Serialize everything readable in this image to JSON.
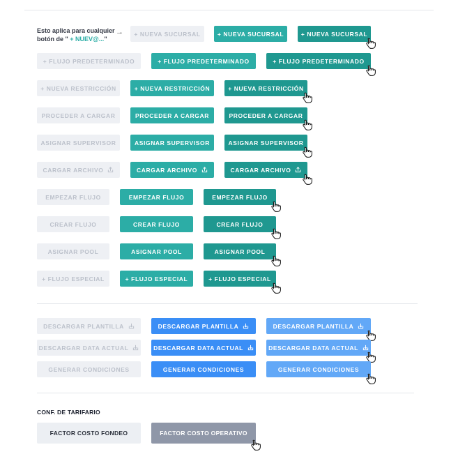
{
  "note": {
    "line1": "Esto aplica para cualquier",
    "line2_prefix": "botón de \"",
    "line2_highlight": " + NUEV@...",
    "line2_suffix": "\"",
    "arrow": "→"
  },
  "rows": [
    {
      "disabled": "+ NUEVA SUCURSAL",
      "normal": "+ NUEVA SUCURSAL",
      "hover": "+ NUEVA SUCURSAL"
    },
    {
      "disabled": "+  FLUJO PREDETERMINADO",
      "normal": "+  FLUJO PREDETERMINADO",
      "hover": "+  FLUJO PREDETERMINADO"
    },
    {
      "disabled": "+ NUEVA RESTRICCIÓN",
      "normal": "+ NUEVA RESTRICCIÓN",
      "hover": "+ NUEVA RESTRICCIÓN"
    },
    {
      "disabled": "PROCEDER A CARGAR",
      "normal": "PROCEDER A CARGAR",
      "hover": "PROCEDER A CARGAR"
    },
    {
      "disabled": "ASIGNAR SUPERVISOR",
      "normal": "ASIGNAR SUPERVISOR",
      "hover": "ASIGNAR SUPERVISOR"
    },
    {
      "disabled": "CARGAR ARCHIVO",
      "normal": "CARGAR ARCHIVO",
      "hover": "CARGAR ARCHIVO"
    },
    {
      "disabled": "EMPEZAR FLUJO",
      "normal": "EMPEZAR FLUJO",
      "hover": "EMPEZAR FLUJO"
    },
    {
      "disabled": "CREAR FLUJO",
      "normal": "CREAR FLUJO",
      "hover": "CREAR FLUJO"
    },
    {
      "disabled": "ASIGNAR POOL",
      "normal": "ASIGNAR POOL",
      "hover": "ASIGNAR POOL"
    },
    {
      "disabled": "+  FLUJO ESPECIAL",
      "normal": "+  FLUJO ESPECIAL",
      "hover": "+  FLUJO ESPECIAL"
    }
  ],
  "download_rows": [
    {
      "disabled": "DESCARGAR PLANTILLA",
      "normal": "DESCARGAR PLANTILLA",
      "hover": "DESCARGAR PLANTILLA"
    },
    {
      "disabled": "DESCARGAR DATA ACTUAL",
      "normal": "DESCARGAR DATA ACTUAL",
      "hover": "DESCARGAR DATA ACTUAL"
    },
    {
      "disabled": "GENERAR CONDICIONES",
      "normal": "GENERAR CONDICIONES",
      "hover": "GENERAR CONDICIONES"
    }
  ],
  "tarifario": {
    "title": "CONF. DE TARIFARIO",
    "normal": "FACTOR COSTO FONDEO",
    "hover": "FACTOR COSTO OPERATIVO"
  },
  "colors": {
    "disabled_bg": "#eef0f4",
    "teal": "#2cada6",
    "teal_dark": "#1f9890",
    "blue": "#3a8ef6",
    "blue_light": "#62a8f7",
    "gray_light": "#eceff3",
    "gray_dark": "#8f97a8"
  },
  "icons": {
    "upload": "upload-icon",
    "download": "download-icon",
    "cursor": "hand-pointer-icon"
  }
}
